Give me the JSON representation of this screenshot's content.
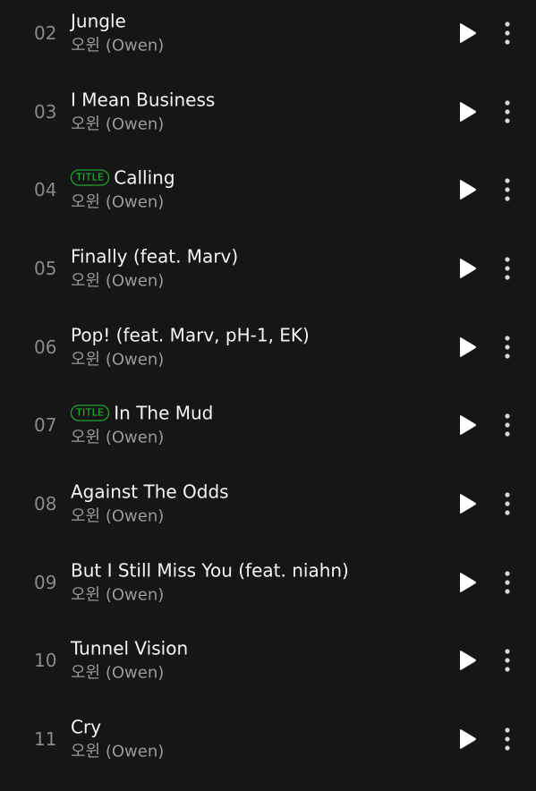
{
  "tracks": [
    {
      "number": "02",
      "title": "Jungle",
      "artist": "오윈 (Owen)",
      "badge": ""
    },
    {
      "number": "03",
      "title": "I Mean Business",
      "artist": "오윈 (Owen)",
      "badge": ""
    },
    {
      "number": "04",
      "title": "Calling",
      "artist": "오윈 (Owen)",
      "badge": "TITLE"
    },
    {
      "number": "05",
      "title": "Finally (feat. Marv)",
      "artist": "오윈 (Owen)",
      "badge": ""
    },
    {
      "number": "06",
      "title": "Pop! (feat. Marv, pH-1, EK)",
      "artist": "오윈 (Owen)",
      "badge": ""
    },
    {
      "number": "07",
      "title": "In The Mud",
      "artist": "오윈 (Owen)",
      "badge": "TITLE"
    },
    {
      "number": "08",
      "title": "Against The Odds",
      "artist": "오윈 (Owen)",
      "badge": ""
    },
    {
      "number": "09",
      "title": "But I Still Miss You (feat. niahn)",
      "artist": "오윈 (Owen)",
      "badge": ""
    },
    {
      "number": "10",
      "title": "Tunnel Vision",
      "artist": "오윈 (Owen)",
      "badge": ""
    },
    {
      "number": "11",
      "title": "Cry",
      "artist": "오윈 (Owen)",
      "badge": ""
    }
  ],
  "icons": {
    "play": "play-icon",
    "more": "more-vertical-icon"
  },
  "colors": {
    "background": "#161616",
    "title_badge": "#20c43a",
    "track_number": "#8a8a8a",
    "artist_text": "#9a9a9a"
  }
}
